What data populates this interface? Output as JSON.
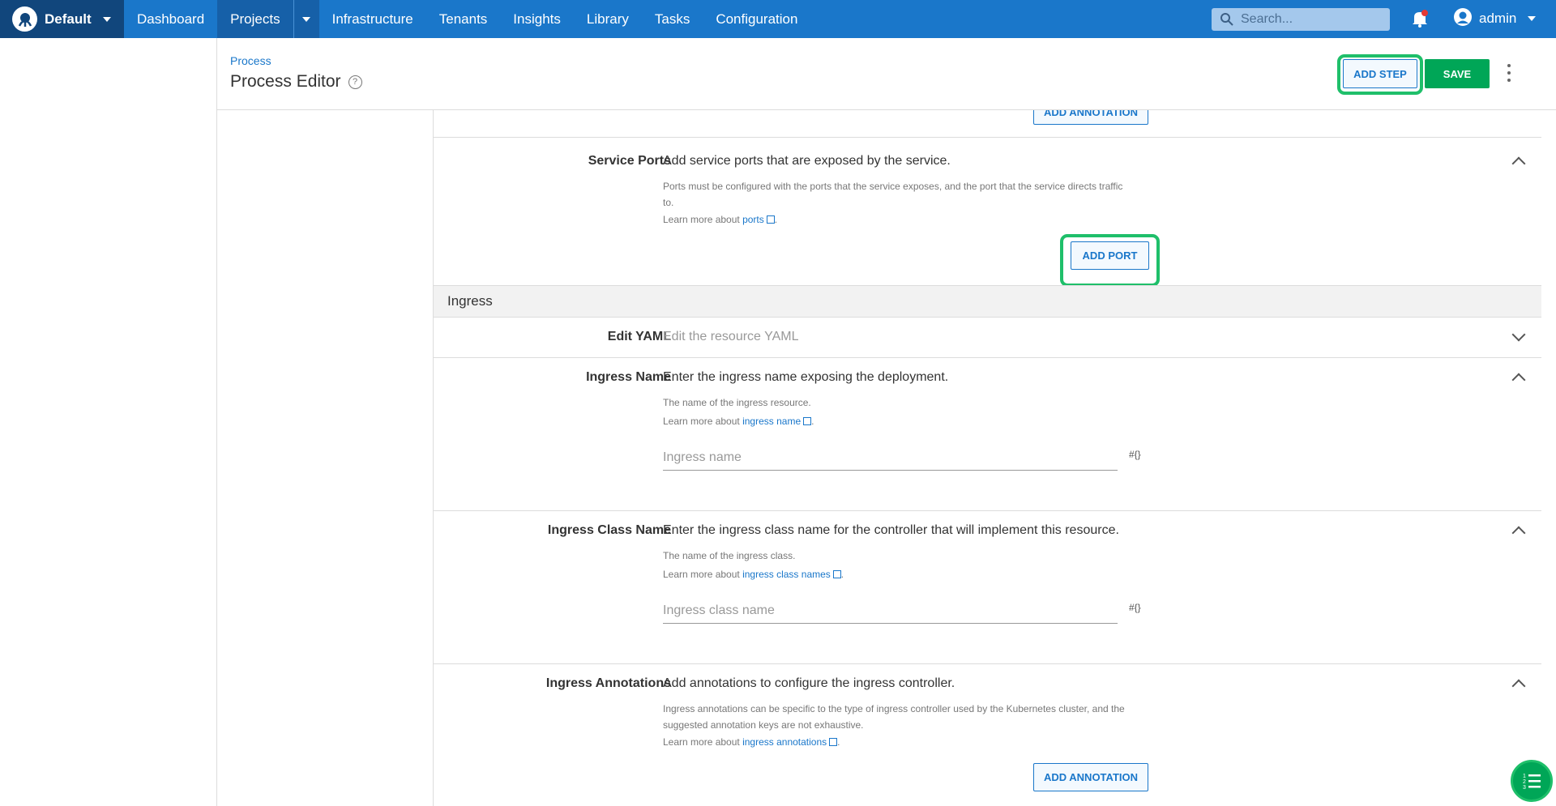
{
  "topbar": {
    "space": "Default",
    "nav": [
      "Dashboard",
      "Projects",
      "Infrastructure",
      "Tenants",
      "Insights",
      "Library",
      "Tasks",
      "Configuration"
    ],
    "search_placeholder": "Search...",
    "user": "admin"
  },
  "header": {
    "breadcrumb": "Process",
    "title": "Process Editor",
    "add_step": "ADD STEP",
    "save": "SAVE"
  },
  "top_partial_button": "ADD ANNOTATION",
  "service_ports": {
    "label": "Service Ports",
    "description": "Add service ports that are exposed by the service.",
    "help_line1": "Ports must be configured with the ports that the service exposes, and the port that the service directs traffic",
    "help_line2": "to.",
    "learn_prefix": "Learn more about",
    "learn_link": "ports",
    "button": "ADD PORT"
  },
  "ingress_group": "Ingress",
  "edit_yaml": {
    "label": "Edit YAML",
    "description": "Edit the resource YAML"
  },
  "ingress_name": {
    "label": "Ingress Name",
    "description": "Enter the ingress name exposing the deployment.",
    "help": "The name of the ingress resource.",
    "learn_prefix": "Learn more about",
    "learn_link": "ingress name",
    "placeholder": "Ingress name",
    "binding": "#{}"
  },
  "ingress_class": {
    "label": "Ingress Class Name",
    "description": "Enter the ingress class name for the controller that will implement this resource.",
    "help": "The name of the ingress class.",
    "learn_prefix": "Learn more about",
    "learn_link": "ingress class names",
    "placeholder": "Ingress class name",
    "binding": "#{}"
  },
  "ingress_annotations": {
    "label": "Ingress Annotations",
    "description": "Add annotations to configure the ingress controller.",
    "help_line1": "Ingress annotations can be specific to the type of ingress controller used by the Kubernetes cluster, and the",
    "help_line2": "suggested annotation keys are not exhaustive.",
    "learn_prefix": "Learn more about",
    "learn_link": "ingress annotations",
    "button": "ADD ANNOTATION"
  },
  "colors": {
    "topbar": "#1a77ca",
    "space_bg": "#11467c",
    "save": "#00a657",
    "highlight": "#1fbf6a"
  }
}
